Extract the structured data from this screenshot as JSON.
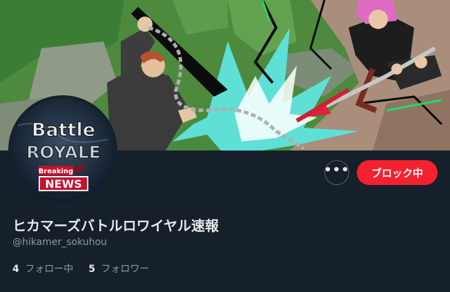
{
  "banner": {
    "image": "anime-battle-scene-banner"
  },
  "avatar": {
    "title_line1": "Battle",
    "title_line2": "ROYALE",
    "badge_top": "Breaking",
    "badge_bottom": "NEWS"
  },
  "actions": {
    "more_label": "•••",
    "block_label": "ブロック中"
  },
  "profile": {
    "display_name": "ヒカマーズバトルロワイヤル速報",
    "handle": "@hikamer_sokuhou"
  },
  "stats": {
    "following_count": "4",
    "following_label": "フォロー中",
    "followers_count": "5",
    "followers_label": "フォロワー"
  },
  "colors": {
    "background": "#15202b",
    "block_button": "#f4212e",
    "secondary_text": "#8b98a5"
  }
}
